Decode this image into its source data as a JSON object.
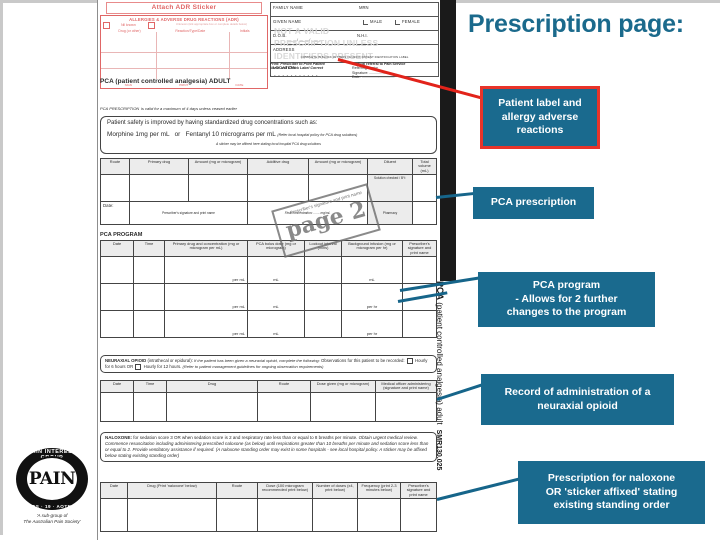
{
  "slide": {
    "title": "Prescription page:"
  },
  "callouts": [
    {
      "id": "patient-label",
      "text": "Patient label and allergy adverse reactions"
    },
    {
      "id": "pca-prescription",
      "text": "PCA prescription"
    },
    {
      "id": "pca-program",
      "text": "PCA program\n- Allows for 2 further changes to the program"
    },
    {
      "id": "neuraxial-record",
      "text": "Record of administration of a neuraxial opioid"
    },
    {
      "id": "naloxone",
      "text": "Prescription for naloxone OR 'sticker affixed' stating existing standing order"
    }
  ],
  "callout_lines": {
    "pca_program_l1": "PCA program",
    "pca_program_l2": "- Allows for 2 further",
    "pca_program_l3": "changes to the program",
    "neuraxial_l1": "Record of administration of a",
    "neuraxial_l2": "neuraxial opioid",
    "naloxone_l1": "Prescription for naloxone",
    "naloxone_l2": "OR 'sticker affixed' stating",
    "naloxone_l3": "existing standing order",
    "patient_l1": "Patient label and",
    "patient_l2": "allergy adverse",
    "patient_l3": "reactions"
  },
  "spine": {
    "caption": "PCA (patient controlled analgesia) adult",
    "caption_bold": "PCA",
    "caption_thin": " (patient controlled analgesia) adult",
    "code": "SMR130.025"
  },
  "logo": {
    "arc_top": "PAIN INTEREST GROUP",
    "arc_bottom": "NURSES  ·  19  ·  AOTEAROA",
    "center": "PAIN",
    "star": "★",
    "caption_l1": "'A sub-group of",
    "caption_l2": "The Australian Pain Society'"
  },
  "form": {
    "adr": {
      "attach": "Attach ADR Sticker",
      "heading": "ALLERGIES & ADVERSE DRUG REACTIONS (ADR)",
      "nil_known": "Nil known",
      "unknown": "Unknown (tick appropriate box or complete details below)",
      "col_drug": "Drug (or other)",
      "col_reaction": "Reaction/Type/Date",
      "col_initials": "Initials",
      "foot_sign": "SIGN",
      "foot_print": "PRINT",
      "foot_date": "DATE"
    },
    "patient": {
      "family_name": "FAMILY NAME",
      "mrn": "MRN",
      "given_name": "GIVEN NAME",
      "male": "MALE",
      "female": "FEMALE",
      "dob": "D.O.B.",
      "dob_line": "____ / ____ / ____",
      "nhi": "N.H.I.",
      "address": "ADDRESS",
      "location": "LOCATION",
      "affix_note": "COMPLETE IN BLOCK LETTERS OR AFFIX PATIENT IDENTIFICATION LABEL",
      "print_note_l1": "Print: Prescriber to Print Patient",
      "print_note_l2": "Name and Check Label Correct",
      "referral_l1": "Medical referral to Pain Service",
      "referral_l2": "Referring doctor",
      "referral_l3": "Signature: ..........................",
      "referral_l4": "Date: .................................",
      "watermark_l1": "NOT A VALID",
      "watermark_l2": "PRESCRIPTION UNLESS",
      "watermark_l3": "IDENTIFIERS PRESENT"
    },
    "doc_title": "PCA (patient controlled analgesia) ADULT",
    "rx_title": "PCA PRESCRIPTION",
    "rx_title_note": "is valid for a maximum of 4 days unless ceased earlier",
    "safety": {
      "line1": "Patient safety is improved by having standardized drug concentrations such as:",
      "line2a": "Morphine 1mg per mL",
      "line2b": "or",
      "line2c": "Fentanyl 10 micrograms per mL",
      "line2d": "(Refer local hospital policy for PCA drug solutions)",
      "line3": "A sticker may be affixed here stating local hospital PCA drug solutions"
    },
    "rx_table": {
      "headers": [
        "Route",
        "Primary drug",
        "Amount (mg or microgram)",
        "Additive drug",
        "Amount (mg or microgram)",
        "Diluent",
        "Total volume (mL)"
      ],
      "row_date_label": "Date:",
      "row_sig_label": "Prescriber's signature and print name",
      "row_concentration": "Final concentration: ....... mg/mL",
      "checked_label": "Solution checked / BY:",
      "pharmacy_label": "Pharmacy"
    },
    "program_title": "PCA PROGRAM",
    "program_table": {
      "headers": [
        "Date",
        "Time",
        "Primary drug and concentration (mg or microgram per mL)",
        "PCA bolus dose (mg or microgram)",
        "Lockout interval (mins)",
        "Background infusion (mg or microgram per hr)",
        "Prescriber's signature and print name"
      ],
      "cell_a": "per mL",
      "cell_b": "mL",
      "cell_c": "per hr"
    },
    "neuraxial": {
      "bold": "NEURAXIAL OPIOID",
      "paren": "(intrathecal or epidural):",
      "ital1": "If the patient has been given a neuraxial opioid,",
      "ital2": "complete the following:",
      "obs": "Observations for this patient to be recorded:",
      "opt1": "Hourly for 6 hours",
      "or": "OR",
      "opt2": "Hourly for 12 hours.",
      "ital3": "(Refer to patient management guidelines for ongoing observation requirements)",
      "headers": [
        "Date",
        "Time",
        "Drug",
        "Route",
        "Dose given (mg or microgram)",
        "Medical officer administering (signature and print name)"
      ]
    },
    "naloxone": {
      "bold": "NALOXONE:",
      "text1": "for sedation score 3 OR when sedation score is 2 and respiratory rate less than or equal to 8 breaths per minute.",
      "ital1": "Obtain urgent medical review. Commence resuscitation including administering prescribed naloxone (as below) until respirations greater than 10 breaths per minute and sedation score less than or equal to 2. Provide ventilatory assistance if required. (A naloxone standing order may exist in some hospitals - see local hospital policy. A sticker may be affixed below stating existing standing order)",
      "headers": [
        "Date",
        "Drug (Print 'naloxone' below)",
        "Route",
        "Dose (100 microgram recommended print below)",
        "Number of doses (x4, print below)",
        "Frequency (print 2-3 minutes below)",
        "Prescriber's signature and print name"
      ]
    },
    "stamp": "page 2",
    "stamp_under": "Prescriber's signature and print name"
  },
  "colors": {
    "title_blue": "#1b6a8c",
    "callout_bg": "#1a6a8e",
    "red_border": "#e8342a",
    "red_arrow": "#e2231a",
    "lead_line": "#16658a",
    "spine_black": "#1a1a1a"
  }
}
